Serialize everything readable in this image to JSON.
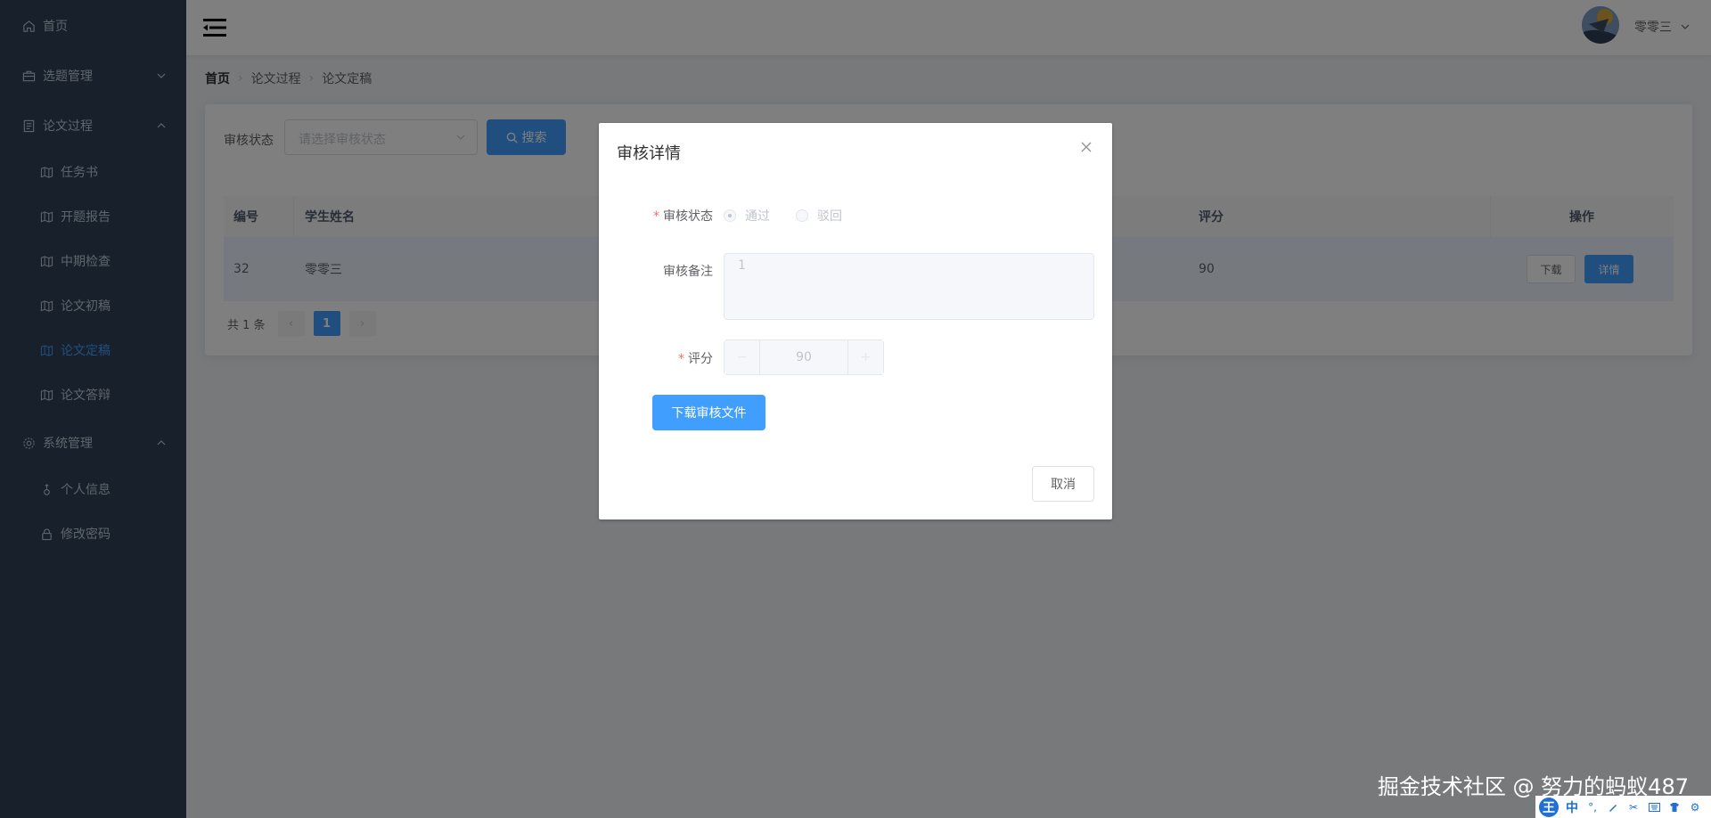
{
  "sidebar": {
    "items": [
      {
        "label": "首页",
        "icon": "home-icon"
      },
      {
        "label": "选题管理",
        "icon": "briefcase-icon"
      },
      {
        "label": "论文过程",
        "icon": "document-icon"
      },
      {
        "label": "任务书",
        "icon": "map-icon"
      },
      {
        "label": "开题报告",
        "icon": "map-icon"
      },
      {
        "label": "中期检查",
        "icon": "map-icon"
      },
      {
        "label": "论文初稿",
        "icon": "map-icon"
      },
      {
        "label": "论文定稿",
        "icon": "map-icon"
      },
      {
        "label": "论文答辩",
        "icon": "map-icon"
      },
      {
        "label": "系统管理",
        "icon": "gear-icon"
      },
      {
        "label": "个人信息",
        "icon": "user-icon"
      },
      {
        "label": "修改密码",
        "icon": "lock-icon"
      }
    ]
  },
  "header": {
    "username": "零零三"
  },
  "breadcrumb": [
    "首页",
    "论文过程",
    "论文定稿"
  ],
  "filter": {
    "label": "审核状态",
    "placeholder": "请选择审核状态",
    "search_label": "搜索"
  },
  "table": {
    "headers": [
      "编号",
      "学生姓名",
      "评分",
      "操作"
    ],
    "rows": [
      {
        "id": "32",
        "name": "零零三",
        "score": "90"
      }
    ],
    "download_label": "下载",
    "detail_label": "详情"
  },
  "pagination": {
    "total": "共 1 条",
    "current": "1"
  },
  "dialog": {
    "title": "审核详情",
    "status_label": "审核状态",
    "option_pass": "通过",
    "option_reject": "驳回",
    "remark_label": "审核备注",
    "remark_value": "1",
    "score_label": "评分",
    "score_value": "90",
    "download_file_label": "下载审核文件",
    "cancel_label": "取消"
  },
  "watermark": "掘金技术社区 @ 努力的蚂蚁487",
  "ime": {
    "logo": "王",
    "mode": "中"
  },
  "colors": {
    "primary": "#409eff",
    "sidebar": "#304156",
    "danger": "#f56c6c"
  }
}
